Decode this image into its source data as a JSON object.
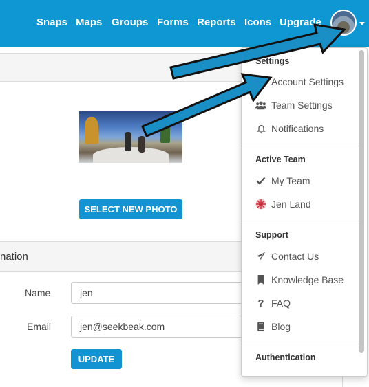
{
  "nav": {
    "links": [
      "Snaps",
      "Maps",
      "Groups",
      "Forms",
      "Reports",
      "Icons",
      "Upgrade"
    ]
  },
  "profile": {
    "select_photo_label": "SELECT NEW PHOTO",
    "section_title": "nation",
    "name_label": "Name",
    "name_value": "jen",
    "email_label": "Email",
    "email_value": "jen@seekbeak.com",
    "update_label": "UPDATE"
  },
  "dropdown": {
    "sections": [
      {
        "header": "Settings",
        "items": [
          {
            "icon": "gear-icon",
            "label": "Account Settings"
          },
          {
            "icon": "team-icon",
            "label": "Team Settings"
          },
          {
            "icon": "bell-icon",
            "label": "Notifications"
          }
        ]
      },
      {
        "header": "Active Team",
        "items": [
          {
            "icon": "check-icon",
            "label": "My Team"
          },
          {
            "icon": "team-avatar-icon",
            "label": "Jen Land"
          }
        ]
      },
      {
        "header": "Support",
        "items": [
          {
            "icon": "send-icon",
            "label": "Contact Us"
          },
          {
            "icon": "bookmark-icon",
            "label": "Knowledge Base"
          },
          {
            "icon": "question-icon",
            "label": "FAQ"
          },
          {
            "icon": "book-icon",
            "label": "Blog"
          }
        ]
      },
      {
        "header": "Authentication",
        "items": []
      }
    ]
  },
  "colors": {
    "brand": "#0e97d2",
    "button": "#1493d2",
    "arrow": "#1a8fc6"
  }
}
